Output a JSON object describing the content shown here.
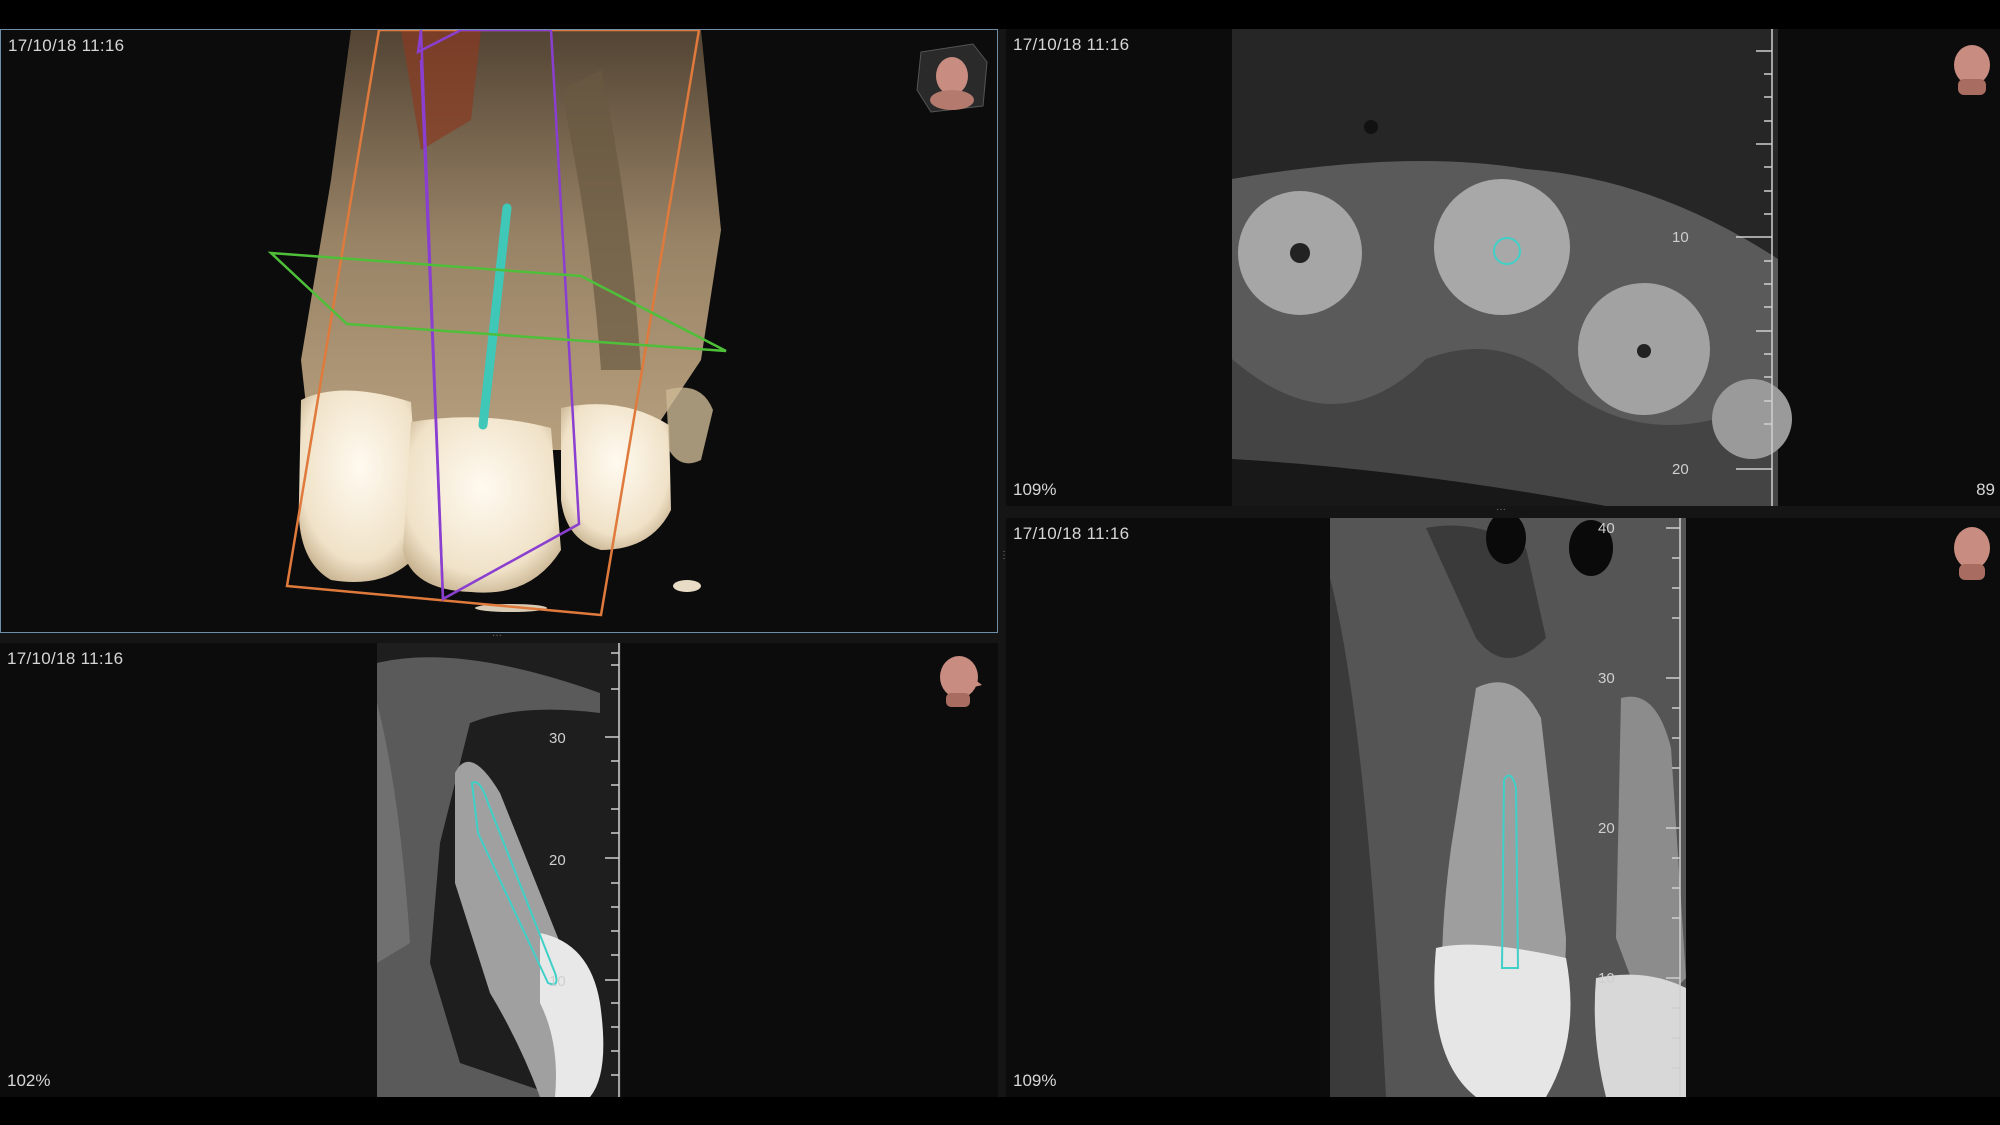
{
  "viewports": {
    "volume_3d": {
      "timestamp": "17/10/18 11:16",
      "orientation_icon": "head-cube-icon"
    },
    "axial": {
      "timestamp": "17/10/18 11:16",
      "zoom": "109%",
      "slice_number": "89",
      "orientation_icon": "head-top-icon",
      "ruler_labels": [
        "10",
        "20"
      ]
    },
    "sagittal": {
      "timestamp": "17/10/18 11:16",
      "zoom": "102%",
      "orientation_icon": "head-side-icon",
      "ruler_labels": [
        "30",
        "20",
        "10"
      ]
    },
    "coronal": {
      "timestamp": "17/10/18 11:16",
      "zoom": "109%",
      "orientation_icon": "head-back-icon",
      "ruler_labels": [
        "40",
        "30",
        "20",
        "10"
      ]
    }
  },
  "colors": {
    "selection_border": "#6f8fa8",
    "canal_outline": "#3fd0c8",
    "plane_orange": "#e07a3c",
    "plane_purple": "#8a3fd0",
    "plane_green": "#4fbf3a"
  }
}
